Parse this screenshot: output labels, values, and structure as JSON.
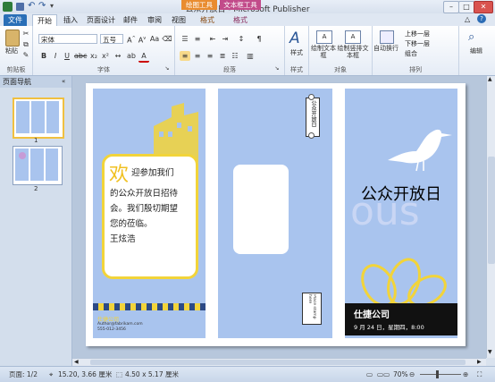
{
  "window": {
    "title": "公众开放日 - Microsoft Publisher",
    "context_tab_drawing": "绘图工具",
    "context_tab_textbox": "文本框工具",
    "minimize": "–",
    "maximize": "□",
    "close": "✕"
  },
  "tabs": [
    "文件",
    "开始",
    "插入",
    "页面设计",
    "邮件",
    "审阅",
    "视图",
    "格式",
    "格式"
  ],
  "ribbon": {
    "clipboard": {
      "paste": "粘贴",
      "label": "剪贴板"
    },
    "font": {
      "name": "宋体",
      "size": "五号",
      "label": "字体"
    },
    "paragraph": {
      "label": "段落"
    },
    "styles": {
      "button": "样式",
      "label": "样式"
    },
    "objects": {
      "draw_textbox": "绘制文本框",
      "draw_vertical_textbox": "绘制竖排文本框",
      "label": "对象"
    },
    "arrange": {
      "wrap": "自动换行",
      "bring_forward": "上移一层",
      "send_backward": "下移一层",
      "group": "组合",
      "label": "排列"
    },
    "editing": {
      "button": "编辑"
    }
  },
  "nav": {
    "header": "页面导航",
    "pages": [
      "1",
      "2"
    ]
  },
  "publication": {
    "left_panel": {
      "big_char": "欢",
      "invite_first": "迎参加我们",
      "invite_rest": [
        "的公众开放日招待",
        "会。我们殷切期望",
        "您的莅临。"
      ],
      "signature": "王炫浩",
      "footer_name": "仕捷公司",
      "footer_line1": "Author@fabrikam.com",
      "footer_line2": "555-012-3456"
    },
    "middle_panel": {
      "vertical_text": "公众开放日",
      "stamp_text": "Place stamp here"
    },
    "right_panel": {
      "title": "公众开放日",
      "watermark": "ous",
      "company": "仕捷公司",
      "date": "9 月 24 日，星期四，8:00"
    }
  },
  "status": {
    "page": "页面: 1/2",
    "position": "15.20, 3.66 厘米",
    "size": "4.50 x 5.17 厘米",
    "zoom": "70%"
  },
  "colors": {
    "panel_blue": "#a9c4ee",
    "accent_yellow": "#f2d43a",
    "file_tab": "#2a6fb7",
    "context_drawing": "#e98c2f",
    "context_text": "#c24b8a"
  }
}
